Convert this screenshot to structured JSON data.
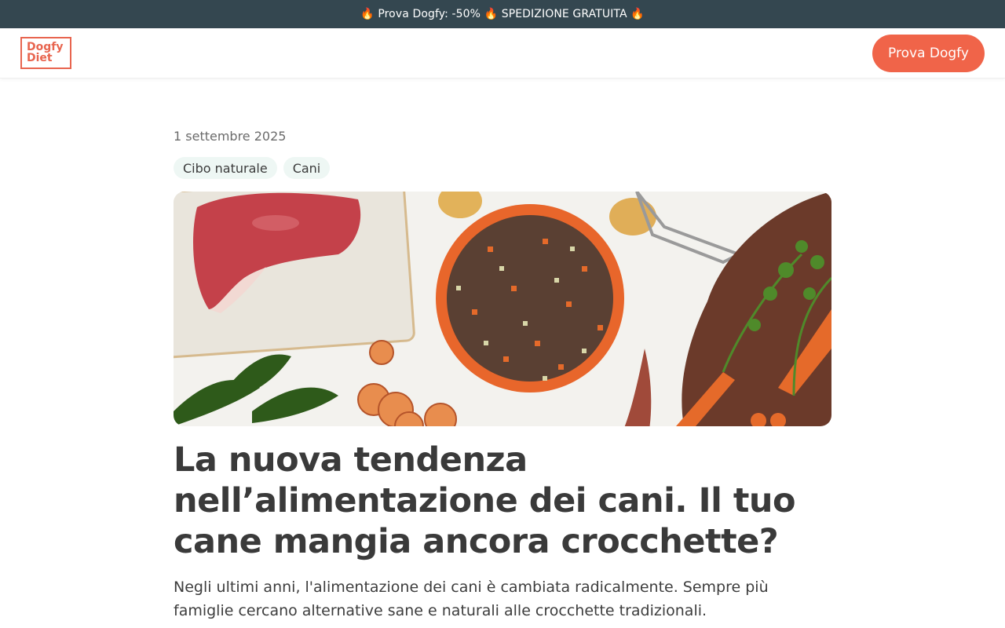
{
  "promo": {
    "text": "🔥 Prova Dogfy: -50% 🔥 SPEDIZIONE GRATUITA 🔥"
  },
  "header": {
    "logo_line1": "Dogfy",
    "logo_line2": "Diet",
    "cta_label": "Prova Dogfy"
  },
  "article": {
    "date": "1 settembre 2025",
    "tags": [
      "Cibo naturale",
      "Cani"
    ],
    "title": "La nuova tendenza nell’alimentazione dei cani. Il tuo cane mangia ancora crocchette?",
    "intro": "Negli ultimi anni, l'alimentazione dei cani è cambiata radicalmente. Sempre più famiglie cercano alternative sane e naturali alle crocchette tradizionali."
  },
  "colors": {
    "promo_bg": "#344750",
    "accent": "#f06449",
    "tag_bg": "#eef7f4",
    "title": "#3a3a3a"
  }
}
